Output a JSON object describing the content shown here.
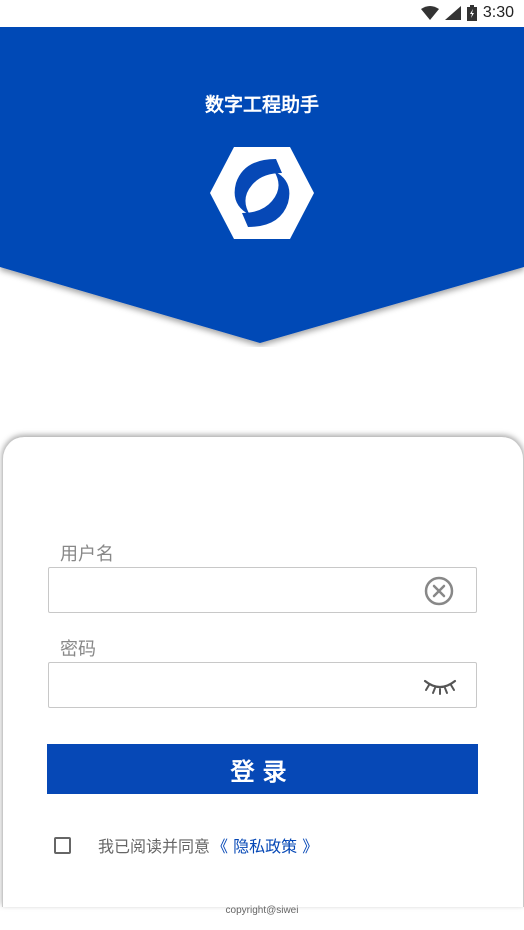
{
  "status_bar": {
    "time": "3:30",
    "icons": [
      "wifi-icon",
      "signal-icon",
      "battery-icon"
    ]
  },
  "header": {
    "title": "数字工程助手",
    "background_color": "#0648b6",
    "logo": "app-logo-icon"
  },
  "form": {
    "username_label": "用户名",
    "username_value": "",
    "password_label": "密码",
    "password_value": "",
    "clear_icon": "clear-circle-icon",
    "visibility_icon": "eye-closed-icon"
  },
  "login_button": {
    "label": "登录"
  },
  "agreement": {
    "checked": false,
    "text": "我已阅读并同意",
    "link_text": "《 隐私政策 》"
  },
  "footer": {
    "copyright": "copyright@siwei"
  },
  "colors": {
    "primary": "#0648b6",
    "label": "#888888",
    "text": "#666666"
  }
}
